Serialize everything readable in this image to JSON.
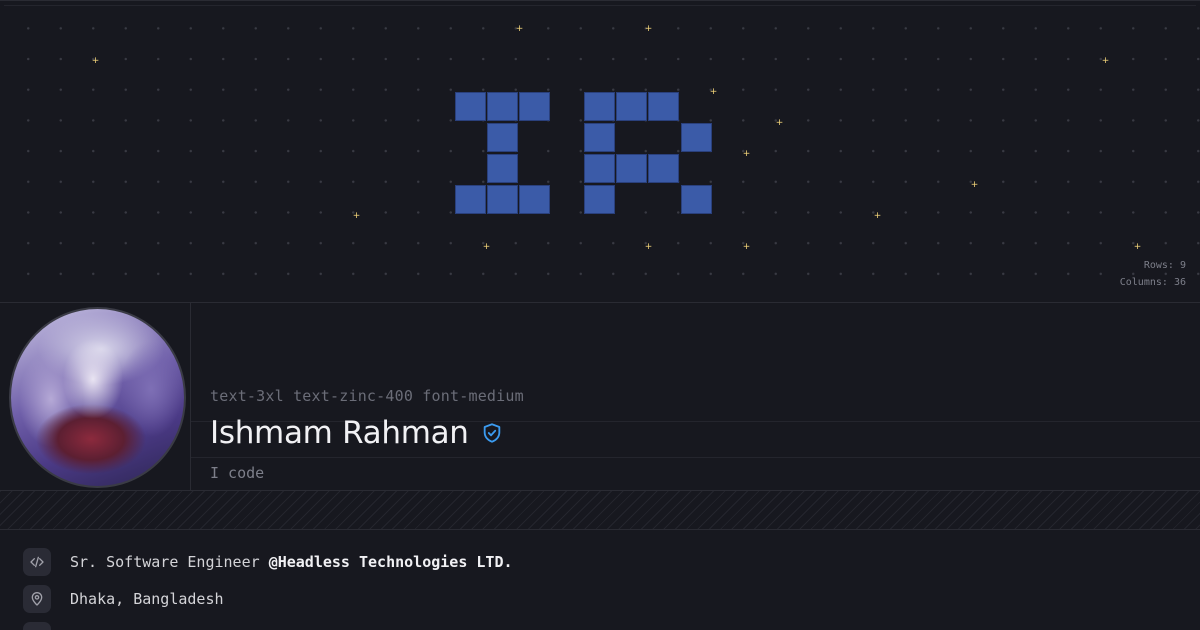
{
  "hero": {
    "rows_label": "Rows:",
    "rows_value": "9",
    "columns_label": "Columns:",
    "columns_value": "36",
    "pixel_color": "#3b5ba8",
    "star_color": "#f5d67a"
  },
  "profile": {
    "avatar_alt": "avatar",
    "class_hint": "text-3xl text-zinc-400 font-medium",
    "name": "Ishmam Rahman",
    "verified_icon": "verified-shield-icon",
    "tagline": "I code"
  },
  "details": {
    "job_prefix": "Sr. Software Engineer ",
    "job_company": "@Headless Technologies LTD.",
    "location": "Dhaka, Bangladesh",
    "job_icon": "code-icon",
    "location_icon": "map-pin-icon"
  },
  "colors": {
    "background": "#17181f",
    "accent_blue": "#3b82f6",
    "text_primary": "#f1f1f4",
    "text_muted": "#7d7f8a"
  }
}
